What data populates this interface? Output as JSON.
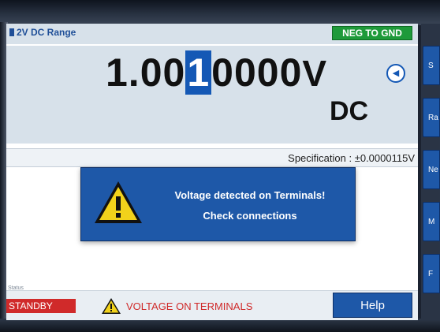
{
  "header": {
    "range_label": "2V DC Range",
    "neg_to_gnd_badge": "NEG TO GND"
  },
  "reading": {
    "digits_before_cursor": "1.00",
    "cursor_digit": "1",
    "digits_after_cursor": "0000",
    "unit": "V",
    "mode": "DC"
  },
  "specification": {
    "text": "Specification : ±0.0000115V"
  },
  "alert": {
    "line1": "Voltage detected on Terminals!",
    "line2": "Check connections",
    "icon": "warning-triangle-icon"
  },
  "status": {
    "caption": "Status",
    "standby": "STANDBY",
    "warning": "VOLTAGE ON TERMINALS"
  },
  "help_label": "Help",
  "softkeys": [
    {
      "label": "S"
    },
    {
      "label": "Ra"
    },
    {
      "label": "Ne"
    },
    {
      "label": "M"
    },
    {
      "label": "F"
    }
  ],
  "colors": {
    "accent_blue": "#1e58a8",
    "badge_green": "#1e9a3a",
    "alert_red": "#d02a2a",
    "warning_yellow": "#f2d21b"
  }
}
